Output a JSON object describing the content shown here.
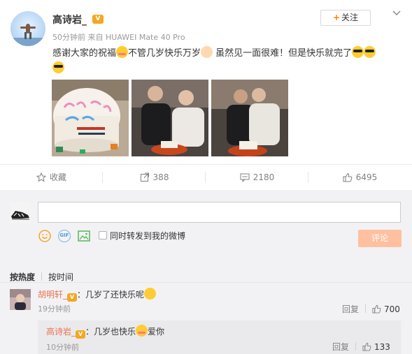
{
  "post": {
    "username": "高诗岩_",
    "meta_time": "50分钟前",
    "meta_from": "来自",
    "meta_device": "HUAWEI Mate 40 Pro",
    "follow_label": "关注",
    "text_part1": "感谢大家的祝福",
    "text_part2": "不管几岁快乐万岁",
    "text_part3": " 虽然见一面很难！但是快乐就完了"
  },
  "actions": {
    "favorite_label": "收藏",
    "repost_count": "388",
    "comment_count": "2180",
    "like_count": "6495"
  },
  "composer": {
    "input_value": "",
    "input_placeholder": "",
    "repost_checkbox_label": "同时转发到我的微博",
    "submit_label": "评论",
    "gif_label": "GIF"
  },
  "sort": {
    "by_hot": "按热度",
    "by_time": "按时间"
  },
  "comments": [
    {
      "name": "胡明轩_",
      "text": "：几岁了还快乐呢",
      "time": "19分钟前",
      "reply_label": "回复",
      "likes": "700",
      "reply": {
        "name": "高诗岩_",
        "text_before": "：几岁也快乐",
        "text_after": "爱你",
        "time": "10分钟前",
        "reply_label": "回复",
        "likes": "133"
      }
    }
  ],
  "colors": {
    "accent_orange": "#ff8200",
    "name_orange": "#eb7350",
    "submit_disabled": "#ffc09f"
  }
}
